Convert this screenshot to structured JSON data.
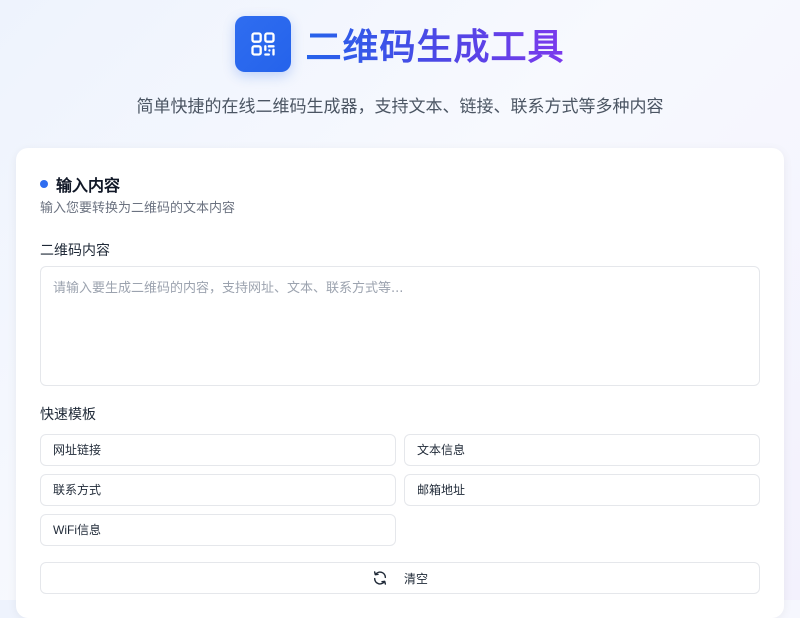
{
  "header": {
    "logo_icon": "qr-code-icon",
    "title": "二维码生成工具",
    "subtitle": "简单快捷的在线二维码生成器，支持文本、链接、联系方式等多种内容"
  },
  "input_section": {
    "title": "输入内容",
    "description": "输入您要转换为二维码的文本内容",
    "content_label": "二维码内容",
    "content_value": "",
    "content_placeholder": "请输入要生成二维码的内容，支持网址、文本、联系方式等...",
    "templates_label": "快速模板",
    "templates": [
      "网址链接",
      "文本信息",
      "联系方式",
      "邮箱地址",
      "WiFi信息"
    ],
    "clear_icon": "refresh-icon",
    "clear_label": "清空"
  },
  "colors": {
    "accent": "#2563eb",
    "title_gradient_end": "#7c3aed"
  }
}
